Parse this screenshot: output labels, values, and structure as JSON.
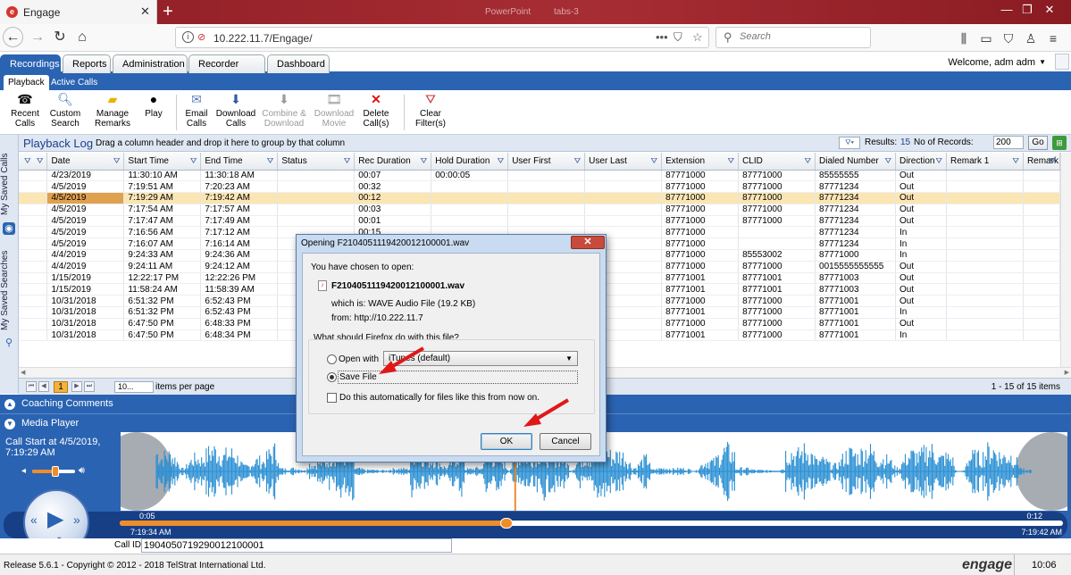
{
  "browser": {
    "tab_title": "Engage",
    "bg_tab_1": "PowerPoint",
    "bg_tab_2": "tabs-3",
    "url": "10.222.11.7/Engage/",
    "search_placeholder": "Search"
  },
  "app": {
    "tabs": [
      "Recordings",
      "Reports",
      "Administration",
      "Recorder Admin",
      "Dashboard"
    ],
    "welcome": "Welcome,  adm adm",
    "subtabs": [
      "Playback",
      "Active Calls"
    ]
  },
  "toolbar": {
    "recent_calls": "Recent Calls",
    "custom_search": "Custom Search",
    "manage_remarks": "Manage Remarks",
    "play": "Play",
    "email_calls": "Email Calls",
    "download_calls": "Download Calls",
    "combine_download": "Combine & Download",
    "download_movie": "Download Movie",
    "delete_calls": "Delete Call(s)",
    "clear_filters": "Clear Filter(s)"
  },
  "sidebar": {
    "saved_calls": "My Saved Calls",
    "saved_searches": "My Saved Searches"
  },
  "playback": {
    "title": "Playback Log",
    "hint": "Drag a column header and drop it here to group by that column",
    "results_label": "Results:",
    "results_count": "15",
    "records_label": "No of Records:",
    "records_value": "200",
    "go_label": "Go"
  },
  "grid": {
    "columns": [
      "Date",
      "Start Time",
      "End Time",
      "Status",
      "Rec Duration",
      "Hold Duration",
      "User First",
      "User Last",
      "Extension",
      "CLID",
      "Dialed Number",
      "Direction",
      "Remark 1",
      "Remark"
    ],
    "rows": [
      [
        "4/23/2019",
        "11:30:10 AM",
        "11:30:18 AM",
        "",
        "00:07",
        "00:00:05",
        "",
        "",
        "87771000",
        "87771000",
        "85555555",
        "Out",
        "",
        ""
      ],
      [
        "4/5/2019",
        "7:19:51 AM",
        "7:20:23 AM",
        "",
        "00:32",
        "",
        "",
        "",
        "87771000",
        "87771000",
        "87771234",
        "Out",
        "",
        ""
      ],
      [
        "4/5/2019",
        "7:19:29 AM",
        "7:19:42 AM",
        "",
        "00:12",
        "",
        "",
        "",
        "87771000",
        "87771000",
        "87771234",
        "Out",
        "",
        ""
      ],
      [
        "4/5/2019",
        "7:17:54 AM",
        "7:17:57 AM",
        "",
        "00:03",
        "",
        "",
        "",
        "87771000",
        "87771000",
        "87771234",
        "Out",
        "",
        ""
      ],
      [
        "4/5/2019",
        "7:17:47 AM",
        "7:17:49 AM",
        "",
        "00:01",
        "",
        "",
        "",
        "87771000",
        "87771000",
        "87771234",
        "Out",
        "",
        ""
      ],
      [
        "4/5/2019",
        "7:16:56 AM",
        "7:17:12 AM",
        "",
        "00:15",
        "",
        "",
        "",
        "87771000",
        "",
        "87771234",
        "In",
        "",
        ""
      ],
      [
        "4/5/2019",
        "7:16:07 AM",
        "7:16:14 AM",
        "",
        "",
        "",
        "",
        "",
        "87771000",
        "",
        "87771234",
        "In",
        "",
        ""
      ],
      [
        "4/4/2019",
        "9:24:33 AM",
        "9:24:36 AM",
        "",
        "",
        "",
        "",
        "",
        "87771000",
        "85553002",
        "87771000",
        "In",
        "",
        ""
      ],
      [
        "4/4/2019",
        "9:24:11 AM",
        "9:24:12 AM",
        "",
        "",
        "",
        "",
        "",
        "87771000",
        "87771000",
        "0015555555555",
        "Out",
        "",
        ""
      ],
      [
        "1/15/2019",
        "12:22:17 PM",
        "12:22:26 PM",
        "",
        "",
        "",
        "",
        "",
        "87771001",
        "87771001",
        "87771003",
        "Out",
        "",
        ""
      ],
      [
        "1/15/2019",
        "11:58:24 AM",
        "11:58:39 AM",
        "",
        "",
        "",
        "",
        "",
        "87771001",
        "87771001",
        "87771003",
        "Out",
        "",
        ""
      ],
      [
        "10/31/2018",
        "6:51:32 PM",
        "6:52:43 PM",
        "",
        "",
        "",
        "",
        "",
        "87771000",
        "87771000",
        "87771001",
        "Out",
        "",
        ""
      ],
      [
        "10/31/2018",
        "6:51:32 PM",
        "6:52:43 PM",
        "",
        "",
        "",
        "",
        "",
        "87771001",
        "87771000",
        "87771001",
        "In",
        "",
        ""
      ],
      [
        "10/31/2018",
        "6:47:50 PM",
        "6:48:33 PM",
        "",
        "",
        "",
        "",
        "",
        "87771000",
        "87771000",
        "87771001",
        "Out",
        "",
        ""
      ],
      [
        "10/31/2018",
        "6:47:50 PM",
        "6:48:34 PM",
        "",
        "",
        "",
        "",
        "",
        "87771001",
        "87771000",
        "87771001",
        "In",
        "",
        ""
      ]
    ],
    "selected_row": 2
  },
  "pager": {
    "current_page": "1",
    "page_size": "10...",
    "items_label": "items per page",
    "summary": "1 - 15 of 15 items"
  },
  "panels": {
    "coaching": "Coaching Comments",
    "media": "Media Player"
  },
  "player": {
    "call_start": "Call Start at 4/5/2019, 7:19:29 AM",
    "elapsed": "0:05",
    "total": "0:12",
    "clock_start": "7:19:34 AM",
    "clock_end": "7:19:42 AM",
    "callid_label": "Call ID",
    "callid_value": "1904050719290012100001",
    "progress": 0.41,
    "volume": 0.55
  },
  "footer": {
    "release": "Release 5.6.1 - Copyright © 2012 - 2018 TelStrat International Ltd.",
    "logo": "engage",
    "clock": "10:06"
  },
  "dialog": {
    "title": "Opening F2104051119420012100001.wav",
    "chosen": "You have chosen to open:",
    "filename": "F2104051119420012100001.wav",
    "which_is": "which is:  WAVE Audio File (19.2 KB)",
    "from": "from:  http://10.222.11.7",
    "question": "What should Firefox do with this file?",
    "open_with": "Open with",
    "open_with_app": "iTunes (default)",
    "save_file": "Save File",
    "auto": "Do this automatically for files like this from now on.",
    "ok": "OK",
    "cancel": "Cancel"
  },
  "colors": {
    "accent": "#2a63b2",
    "selected_row": "#fbe6b3",
    "waveform": "#2a8fd3",
    "arrow": "#e01818"
  }
}
